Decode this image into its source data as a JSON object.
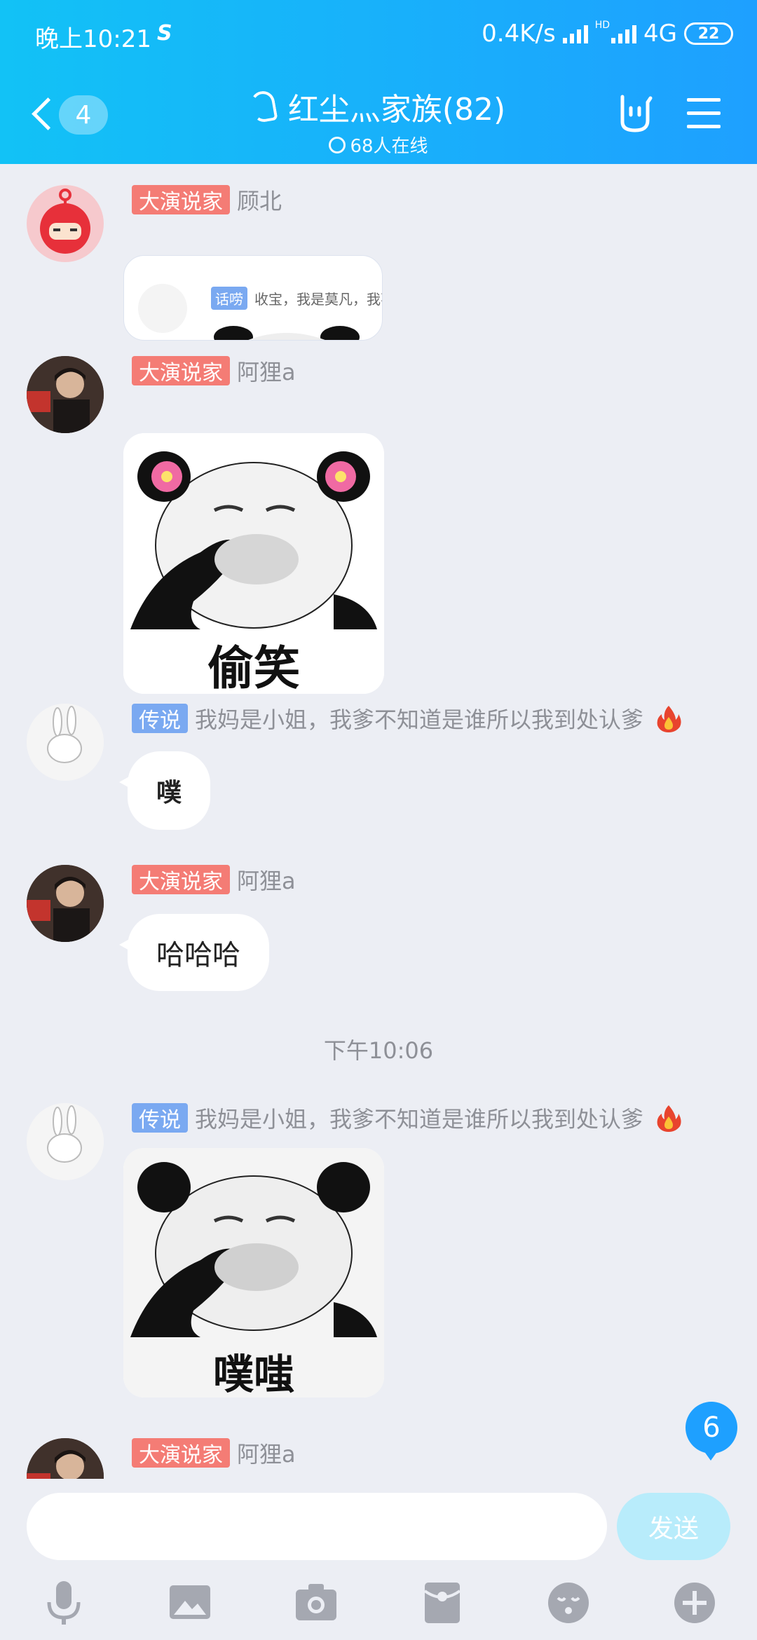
{
  "status_bar": {
    "time": "晚上10:21",
    "app_mark": "S",
    "net_speed": "0.4K/s",
    "hd": "HD",
    "network": "4G",
    "battery": "22"
  },
  "header": {
    "unread_count": "4",
    "title": "红尘灬家族(82)",
    "online": "68人在线"
  },
  "messages": [
    {
      "badge": "大演说家",
      "name": "顾北",
      "quote_tag": "话唠",
      "quote_text": "收宝，我是莫凡，我不"
    },
    {
      "badge": "大演说家",
      "name": "阿狸a",
      "sticker_text": "偷笑"
    },
    {
      "badge": "传说",
      "name": "我妈是小姐，我爹不知道是谁所以我到处认爹",
      "text": "噗"
    },
    {
      "badge": "大演说家",
      "name": "阿狸a",
      "text": "哈哈哈"
    },
    {
      "badge": "传说",
      "name": "我妈是小姐，我爹不知道是谁所以我到处认爹",
      "sticker_text": "噗嗤"
    },
    {
      "badge": "大演说家",
      "name": "阿狸a"
    }
  ],
  "timeline": "下午10:06",
  "floating_unread": "6",
  "input": {
    "value": "",
    "send_label": "发送"
  },
  "toolbar": [
    "microphone-icon",
    "image-icon",
    "camera-icon",
    "red-packet-icon",
    "emoji-icon",
    "plus-icon"
  ],
  "colors": {
    "header_start": "#12c2f6",
    "header_end": "#1ea0ff",
    "badge_red": "#f47c75",
    "badge_blue": "#7aa9f1",
    "background": "#eceef4",
    "send_disabled": "#b8ecfb",
    "toolbar_icon": "#a5a8b1"
  }
}
